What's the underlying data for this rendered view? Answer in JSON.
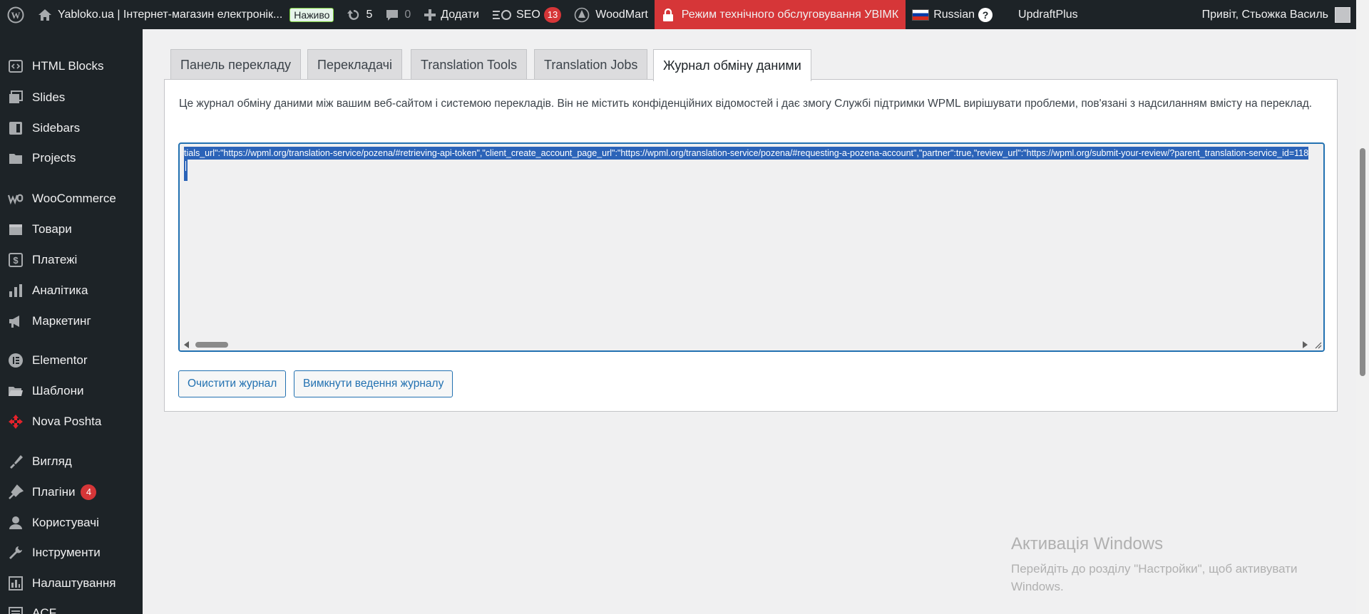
{
  "adminbar": {
    "site_title": "Yabloko.ua | Інтернет-магазин електронік...",
    "live_badge": "Наживо",
    "updates_count": "5",
    "comments_count": "0",
    "add_new_label": "Додати",
    "seo_label": "SEO",
    "seo_badge": "13",
    "woodmart_label": "WoodMart",
    "maintenance_label": "Режим технічного обслуговування УВІМК",
    "language_label": "Russian",
    "help_label": "?",
    "updraft_label": "UpdraftPlus",
    "greeting": "Привіт, Стьожка Василь"
  },
  "sidebar": {
    "items": [
      {
        "label": "HTML Blocks",
        "icon": "code-block-icon"
      },
      {
        "label": "Slides",
        "icon": "slides-icon"
      },
      {
        "label": "Sidebars",
        "icon": "sidebars-icon"
      },
      {
        "label": "Projects",
        "icon": "projects-icon"
      },
      {
        "label": "WooCommerce",
        "icon": "woocommerce-icon"
      },
      {
        "label": "Товари",
        "icon": "products-icon"
      },
      {
        "label": "Платежі",
        "icon": "payments-icon"
      },
      {
        "label": "Аналітика",
        "icon": "analytics-icon"
      },
      {
        "label": "Маркетинг",
        "icon": "marketing-icon"
      },
      {
        "label": "Elementor",
        "icon": "elementor-icon"
      },
      {
        "label": "Шаблони",
        "icon": "templates-icon"
      },
      {
        "label": "Nova Poshta",
        "icon": "nova-poshta-icon"
      },
      {
        "label": "Вигляд",
        "icon": "appearance-icon"
      },
      {
        "label": "Плагіни",
        "icon": "plugins-icon",
        "badge": "4"
      },
      {
        "label": "Користувачі",
        "icon": "users-icon"
      },
      {
        "label": "Інструменти",
        "icon": "tools-icon"
      },
      {
        "label": "Налаштування",
        "icon": "settings-icon"
      },
      {
        "label": "ACF",
        "icon": "acf-icon"
      }
    ]
  },
  "tabs": [
    {
      "label": "Панель перекладу",
      "active": false
    },
    {
      "label": "Перекладачі",
      "active": false
    },
    {
      "label": "Translation Tools",
      "active": false
    },
    {
      "label": "Translation Jobs",
      "active": false
    },
    {
      "label": "Журнал обміну даними",
      "active": true
    }
  ],
  "panel": {
    "description": "Це журнал обміну даними між вашим веб-сайтом і системою перекладів. Він не містить конфіденційних відомостей і дає змогу Службі підтримки WPML вирішувати проблеми, пов'язані з надсиланням вмісту на переклад.",
    "log_text": "tials_url\":\"https://wpml.org/translation-service/pozena/#retrieving-api-token\",\"client_create_account_page_url\":\"https://wpml.org/translation-service/pozena/#requesting-a-pozena-account\",\"partner\":true,\"review_url\":\"https://wpml.org/submit-your-review/?parent_translation-service_id=118",
    "clear_log_button": "Очистити журнал",
    "disable_log_button": "Вимкнути ведення журналу"
  },
  "watermark": {
    "title": "Активація Windows",
    "subtitle": "Перейдіть до розділу \"Настройки\", щоб активувати Windows."
  },
  "colors": {
    "adminbar_bg": "#1d2327",
    "accent": "#2271b1",
    "maintenance_bg": "#d63638",
    "badge_red": "#d63638"
  }
}
